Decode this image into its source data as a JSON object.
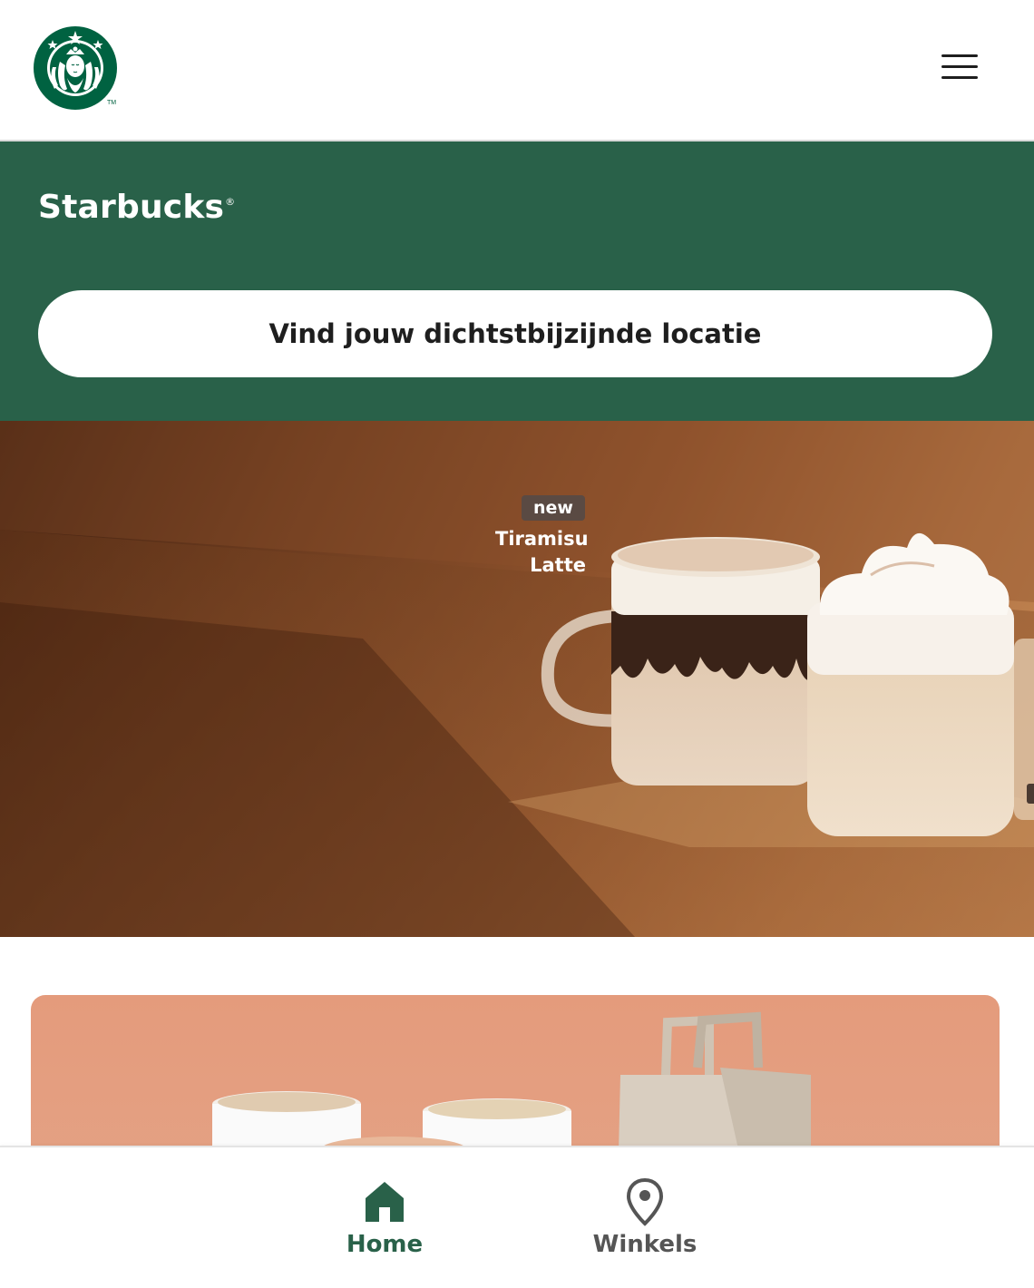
{
  "header": {
    "logo_alt": "Starbucks logo",
    "menu_icon": "hamburger-menu-icon"
  },
  "hero": {
    "brand": "Starbucks",
    "brand_mark": "®",
    "locate_button": "Vind jouw dichtstbijzijnde locatie"
  },
  "banner": {
    "badge": "new",
    "product_line1": "Tiramisu",
    "product_line2": "Latte"
  },
  "tabbar": {
    "tabs": [
      {
        "label": "Home",
        "icon": "home-icon",
        "active": true
      },
      {
        "label": "Winkels",
        "icon": "location-pin-icon",
        "active": false
      }
    ]
  },
  "colors": {
    "brand_green": "#296149",
    "header_bg": "#ffffff",
    "inactive_tab": "#555555"
  }
}
